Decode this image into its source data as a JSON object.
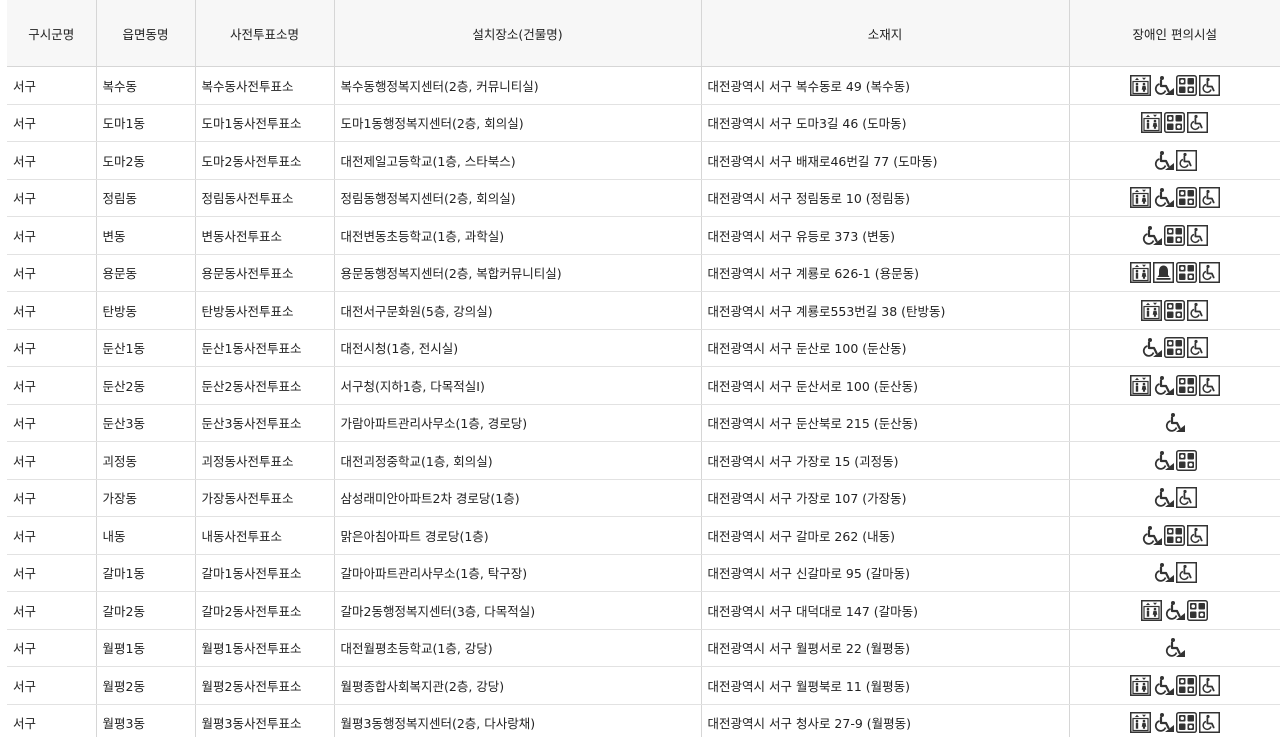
{
  "table": {
    "headers": [
      "구시군명",
      "읍면동명",
      "사전투표소명",
      "설치장소(건물명)",
      "소재지",
      "장애인 편의시설"
    ],
    "rows": [
      {
        "gu": "서구",
        "dong": "복수동",
        "station": "복수동사전투표소",
        "place": "복수동행정복지센터(2층, 커뮤니티실)",
        "address": "대전광역시 서구 복수동로 49 (복수동)",
        "icons": [
          "elevator-icon",
          "ramp-icon",
          "braille-icon",
          "wheelchair-icon"
        ]
      },
      {
        "gu": "서구",
        "dong": "도마1동",
        "station": "도마1동사전투표소",
        "place": "도마1동행정복지센터(2층, 회의실)",
        "address": "대전광역시 서구 도마3길 46 (도마동)",
        "icons": [
          "elevator-icon",
          "braille-icon",
          "wheelchair-icon"
        ]
      },
      {
        "gu": "서구",
        "dong": "도마2동",
        "station": "도마2동사전투표소",
        "place": "대전제일고등학교(1층, 스타북스)",
        "address": "대전광역시 서구 배재로46번길 77 (도마동)",
        "icons": [
          "ramp-icon",
          "wheelchair-icon"
        ]
      },
      {
        "gu": "서구",
        "dong": "정림동",
        "station": "정림동사전투표소",
        "place": "정림동행정복지센터(2층, 회의실)",
        "address": "대전광역시 서구 정림동로 10 (정림동)",
        "icons": [
          "elevator-icon",
          "ramp-icon",
          "braille-icon",
          "wheelchair-icon"
        ]
      },
      {
        "gu": "서구",
        "dong": "변동",
        "station": "변동사전투표소",
        "place": "대전변동초등학교(1층, 과학실)",
        "address": "대전광역시 서구 유등로 373 (변동)",
        "icons": [
          "ramp-icon",
          "braille-icon",
          "wheelchair-icon"
        ]
      },
      {
        "gu": "서구",
        "dong": "용문동",
        "station": "용문동사전투표소",
        "place": "용문동행정복지센터(2층, 복합커뮤니티실)",
        "address": "대전광역시 서구 계룡로 626-1 (용문동)",
        "icons": [
          "elevator-icon",
          "bell-icon",
          "braille-icon",
          "wheelchair-icon"
        ]
      },
      {
        "gu": "서구",
        "dong": "탄방동",
        "station": "탄방동사전투표소",
        "place": "대전서구문화원(5층, 강의실)",
        "address": "대전광역시 서구 계룡로553번길 38 (탄방동)",
        "icons": [
          "elevator-icon",
          "braille-icon",
          "wheelchair-icon"
        ]
      },
      {
        "gu": "서구",
        "dong": "둔산1동",
        "station": "둔산1동사전투표소",
        "place": "대전시청(1층, 전시실)",
        "address": "대전광역시 서구 둔산로 100 (둔산동)",
        "icons": [
          "ramp-icon",
          "braille-icon",
          "wheelchair-icon"
        ]
      },
      {
        "gu": "서구",
        "dong": "둔산2동",
        "station": "둔산2동사전투표소",
        "place": "서구청(지하1층, 다목적실Ⅰ)",
        "address": "대전광역시 서구 둔산서로 100 (둔산동)",
        "icons": [
          "elevator-icon",
          "ramp-icon",
          "braille-icon",
          "wheelchair-icon"
        ]
      },
      {
        "gu": "서구",
        "dong": "둔산3동",
        "station": "둔산3동사전투표소",
        "place": "가람아파트관리사무소(1층, 경로당)",
        "address": "대전광역시 서구 둔산북로 215 (둔산동)",
        "icons": [
          "ramp-icon"
        ]
      },
      {
        "gu": "서구",
        "dong": "괴정동",
        "station": "괴정동사전투표소",
        "place": "대전괴정중학교(1층, 회의실)",
        "address": "대전광역시 서구 가장로 15 (괴정동)",
        "icons": [
          "ramp-icon",
          "braille-icon"
        ]
      },
      {
        "gu": "서구",
        "dong": "가장동",
        "station": "가장동사전투표소",
        "place": "삼성래미안아파트2차 경로당(1층)",
        "address": "대전광역시 서구 가장로 107 (가장동)",
        "icons": [
          "ramp-icon",
          "wheelchair-icon"
        ]
      },
      {
        "gu": "서구",
        "dong": "내동",
        "station": "내동사전투표소",
        "place": "맑은아침아파트 경로당(1층)",
        "address": "대전광역시 서구 갈마로 262 (내동)",
        "icons": [
          "ramp-icon",
          "braille-icon",
          "wheelchair-icon"
        ]
      },
      {
        "gu": "서구",
        "dong": "갈마1동",
        "station": "갈마1동사전투표소",
        "place": "갈마아파트관리사무소(1층, 탁구장)",
        "address": "대전광역시 서구 신갈마로 95 (갈마동)",
        "icons": [
          "ramp-icon",
          "wheelchair-icon"
        ]
      },
      {
        "gu": "서구",
        "dong": "갈마2동",
        "station": "갈마2동사전투표소",
        "place": "갈마2동행정복지센터(3층, 다목적실)",
        "address": "대전광역시 서구 대덕대로 147 (갈마동)",
        "icons": [
          "elevator-icon",
          "ramp-icon",
          "braille-icon"
        ]
      },
      {
        "gu": "서구",
        "dong": "월평1동",
        "station": "월평1동사전투표소",
        "place": "대전월평초등학교(1층, 강당)",
        "address": "대전광역시 서구 월평서로 22 (월평동)",
        "icons": [
          "ramp-icon"
        ]
      },
      {
        "gu": "서구",
        "dong": "월평2동",
        "station": "월평2동사전투표소",
        "place": "월평종합사회복지관(2층, 강당)",
        "address": "대전광역시 서구 월평북로 11 (월평동)",
        "icons": [
          "elevator-icon",
          "ramp-icon",
          "braille-icon",
          "wheelchair-icon"
        ]
      },
      {
        "gu": "서구",
        "dong": "월평3동",
        "station": "월평3동사전투표소",
        "place": "월평3동행정복지센터(2층, 다사랑채)",
        "address": "대전광역시 서구 청사로 27-9 (월평동)",
        "icons": [
          "elevator-icon",
          "ramp-icon",
          "braille-icon",
          "wheelchair-icon"
        ]
      }
    ]
  }
}
